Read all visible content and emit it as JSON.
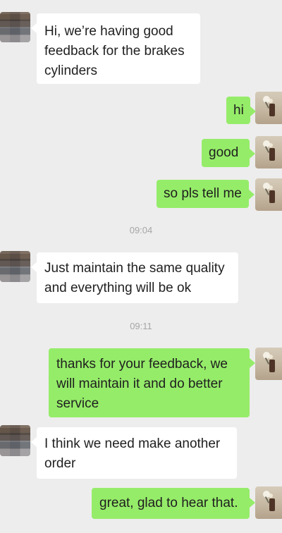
{
  "chat": {
    "messages": [
      {
        "side": "left",
        "text": "Hi, we’re having good\nfeedback for the brakes\ncylinders"
      },
      {
        "side": "right",
        "text": "hi"
      },
      {
        "side": "right",
        "text": "good"
      },
      {
        "side": "right",
        "text": "so pls tell me"
      },
      {
        "type": "time",
        "text": "09:04"
      },
      {
        "side": "left",
        "text": "Just maintain the same quality\nand everything will be ok"
      },
      {
        "type": "time",
        "text": "09:11"
      },
      {
        "side": "right",
        "text": "thanks for your feedback, we\nwill maintain it and do better\nservice"
      },
      {
        "side": "left",
        "text": "I think we need make another\norder"
      },
      {
        "side": "right",
        "text": "great, glad to hear that."
      }
    ]
  },
  "theme": {
    "background": "#ededed",
    "incoming_bubble": "#ffffff",
    "outgoing_bubble": "#95ec69",
    "timestamp_text": "#a6a6a6"
  }
}
